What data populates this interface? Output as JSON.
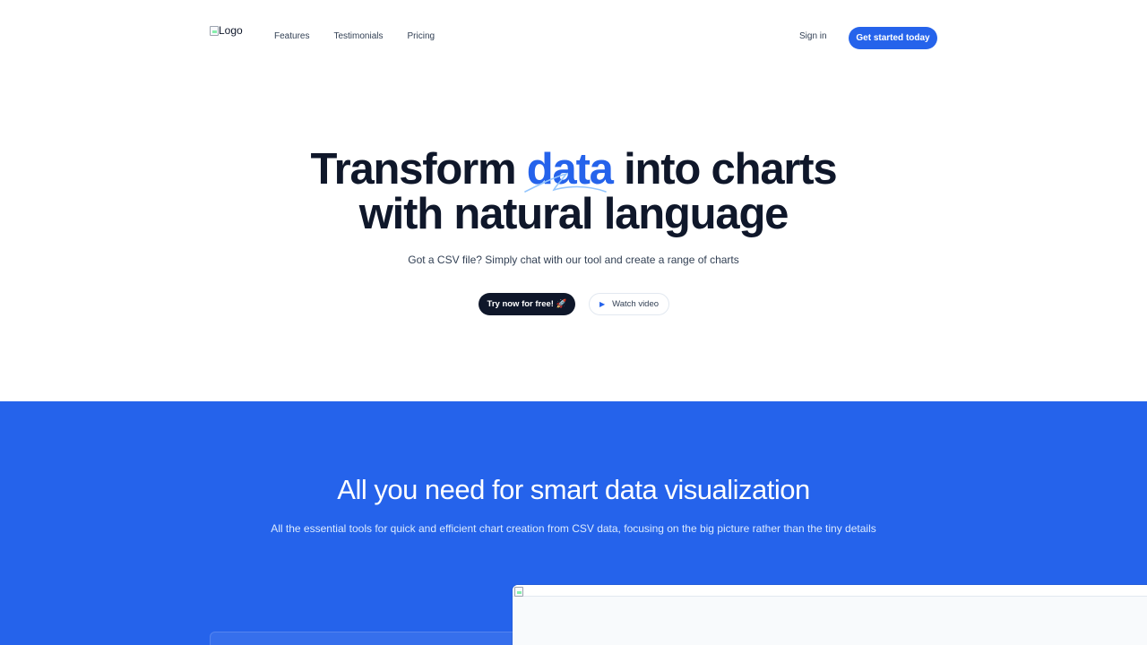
{
  "header": {
    "logo_alt": "Logo",
    "nav": [
      {
        "label": "Features"
      },
      {
        "label": "Testimonials"
      },
      {
        "label": "Pricing"
      }
    ],
    "signin_label": "Sign in",
    "cta_label": "Get started today"
  },
  "hero": {
    "title_part1": "Transform ",
    "title_highlight": "data",
    "title_part2": " into charts",
    "title_line2": "with natural language",
    "subtitle": "Got a CSV file? Simply chat with our tool and create a range of charts",
    "try_label": "Try now for free! 🚀",
    "watch_label": "Watch video",
    "watch_icon": "play-icon"
  },
  "features": {
    "heading": "All you need for smart data visualization",
    "description": "All the essential tools for quick and efficient chart creation from CSV data, focusing on the big picture rather than the tiny details"
  },
  "colors": {
    "accent": "#2563eb",
    "dark": "#0f172a",
    "text": "#334155"
  }
}
